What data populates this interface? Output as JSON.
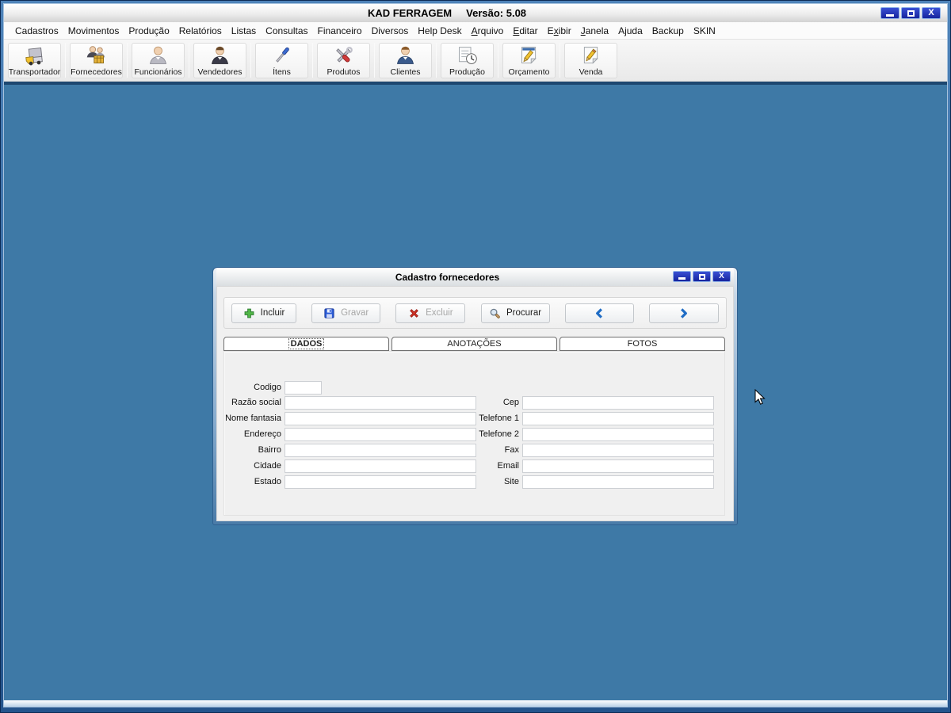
{
  "window": {
    "title": "KAD FERRAGEM",
    "version": "Versão: 5.08"
  },
  "menu_bar": {
    "items": [
      {
        "label": "Cadastros",
        "underline": -1
      },
      {
        "label": "Movimentos",
        "underline": -1
      },
      {
        "label": "Produção",
        "underline": -1
      },
      {
        "label": "Relatórios",
        "underline": -1
      },
      {
        "label": "Listas",
        "underline": -1
      },
      {
        "label": "Consultas",
        "underline": -1
      },
      {
        "label": "Financeiro",
        "underline": -1
      },
      {
        "label": "Diversos",
        "underline": -1
      },
      {
        "label": "Help Desk",
        "underline": -1
      },
      {
        "label": "Arquivo",
        "underline": 0
      },
      {
        "label": "Editar",
        "underline": 0
      },
      {
        "label": "Exibir",
        "underline": 1
      },
      {
        "label": "Janela",
        "underline": 0
      },
      {
        "label": "Ajuda",
        "underline": -1
      },
      {
        "label": "Backup",
        "underline": -1
      },
      {
        "label": "SKIN",
        "underline": -1
      }
    ]
  },
  "toolbar": {
    "buttons": [
      {
        "label": "Transportador",
        "icon": "truck-icon"
      },
      {
        "label": "Fornecedores",
        "icon": "suppliers-icon"
      },
      {
        "label": "Funcionários",
        "icon": "employee-icon"
      },
      {
        "label": "Vendedores",
        "icon": "seller-icon"
      },
      {
        "label": "Ítens",
        "icon": "screwdriver-icon"
      },
      {
        "label": "Produtos",
        "icon": "tools-icon"
      },
      {
        "label": "Clientes",
        "icon": "client-icon"
      },
      {
        "label": "Produção",
        "icon": "production-icon"
      },
      {
        "label": "Orçamento",
        "icon": "budget-icon"
      },
      {
        "label": "Venda",
        "icon": "sale-icon"
      }
    ]
  },
  "dialog": {
    "title": "Cadastro fornecedores",
    "toolbar": {
      "buttons": [
        {
          "label": "Incluir",
          "icon": "plus-icon",
          "enabled": true
        },
        {
          "label": "Gravar",
          "icon": "save-icon",
          "enabled": false
        },
        {
          "label": "Excluir",
          "icon": "delete-icon",
          "enabled": false
        },
        {
          "label": "Procurar",
          "icon": "search-icon",
          "enabled": true
        },
        {
          "label": "",
          "icon": "chevron-left-icon",
          "enabled": true
        },
        {
          "label": "",
          "icon": "chevron-right-icon",
          "enabled": true
        }
      ]
    },
    "tabs": [
      {
        "label": "DADOS",
        "active": true
      },
      {
        "label": "ANOTAÇÕES",
        "active": false
      },
      {
        "label": "FOTOS",
        "active": false
      }
    ],
    "form": {
      "left_fields": [
        {
          "label": "Codigo",
          "value": ""
        },
        {
          "label": "Razão social",
          "value": ""
        },
        {
          "label": "Nome fantasia",
          "value": ""
        },
        {
          "label": "Endereço",
          "value": ""
        },
        {
          "label": "Bairro",
          "value": ""
        },
        {
          "label": "Cidade",
          "value": ""
        },
        {
          "label": "Estado",
          "value": ""
        }
      ],
      "right_fields": [
        {
          "label": "Cep",
          "value": ""
        },
        {
          "label": "Telefone 1",
          "value": ""
        },
        {
          "label": "Telefone 2",
          "value": ""
        },
        {
          "label": "Fax",
          "value": ""
        },
        {
          "label": "Email",
          "value": ""
        },
        {
          "label": "Site",
          "value": ""
        }
      ]
    }
  },
  "colors": {
    "mdi_background": "#3e79a6",
    "frame_blue": "#24548c",
    "window_button_blue": "#1a2a9e",
    "accent_blue": "#1f6cc5",
    "disabled_text": "#a6a6a6"
  }
}
